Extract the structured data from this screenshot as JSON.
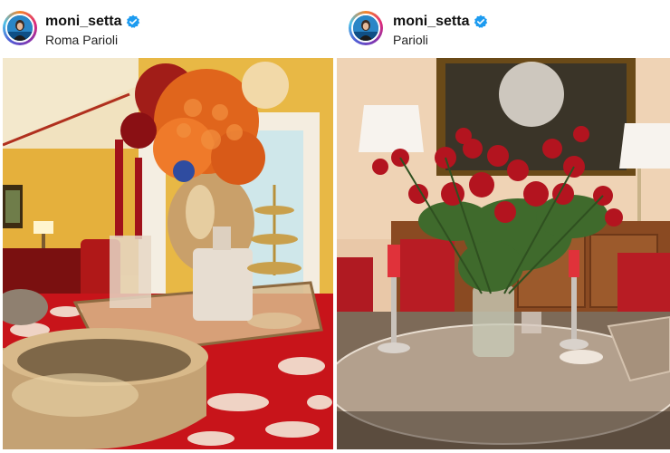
{
  "posts": [
    {
      "username": "moni_setta",
      "location": "Roma Parioli",
      "verified_icon": "verified-badge-icon",
      "badge_color": "#1d9bf0"
    },
    {
      "username": "moni_setta",
      "location": "Parioli",
      "verified_icon": "verified-badge-icon",
      "badge_color": "#1d9bf0"
    }
  ]
}
